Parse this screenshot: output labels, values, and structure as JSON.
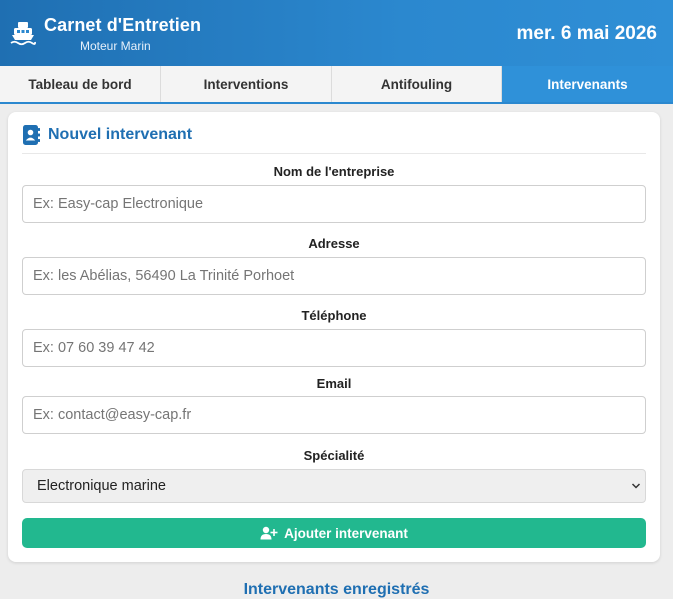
{
  "header": {
    "title": "Carnet d'Entretien",
    "subtitle": "Moteur Marin",
    "date": "mer. 6 mai 2026",
    "icon": "boat-icon"
  },
  "tabs": [
    {
      "label": "Tableau de bord",
      "active": false
    },
    {
      "label": "Interventions",
      "active": false
    },
    {
      "label": "Antifouling",
      "active": false
    },
    {
      "label": "Intervenants",
      "active": true
    }
  ],
  "form": {
    "title": "Nouvel intervenant",
    "icon": "contact-book-icon",
    "fields": {
      "company": {
        "label": "Nom de l'entreprise",
        "placeholder": "Ex: Easy-cap Electronique",
        "value": ""
      },
      "address": {
        "label": "Adresse",
        "placeholder": "Ex: les Abélias, 56490 La Trinité Porhoet",
        "value": ""
      },
      "phone": {
        "label": "Téléphone",
        "placeholder": "Ex: 07 60 39 47 42",
        "value": ""
      },
      "email": {
        "label": "Email",
        "placeholder": "Ex: contact@easy-cap.fr",
        "value": ""
      },
      "specialty": {
        "label": "Spécialité",
        "selected": "Electronique marine"
      }
    },
    "submit_label": "Ajouter intervenant",
    "submit_icon": "user-plus-icon"
  },
  "saved_section": {
    "title": "Intervenants enregistrés"
  },
  "colors": {
    "header_blue": "#1f6fb2",
    "tab_active": "#2f91d9",
    "submit_green": "#22b88f"
  }
}
